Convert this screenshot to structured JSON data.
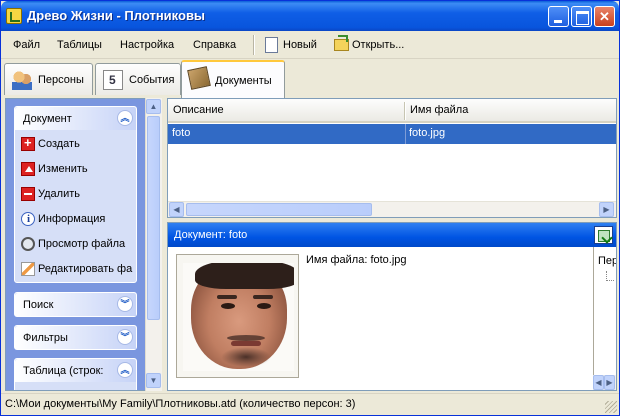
{
  "window": {
    "title": "Древо Жизни - Плотниковы"
  },
  "menu": {
    "items": [
      "Файл",
      "Таблицы",
      "Настройка",
      "Справка"
    ],
    "new_label": "Новый",
    "open_label": "Открыть..."
  },
  "tabs": [
    {
      "label": "Персоны",
      "active": false
    },
    {
      "label": "События",
      "active": false
    },
    {
      "label": "Документы",
      "active": true
    }
  ],
  "sidebar": {
    "document_panel": {
      "title": "Документ",
      "tasks": [
        "Создать",
        "Изменить",
        "Удалить",
        "Информация",
        "Просмотр файла",
        "Редактировать фа"
      ]
    },
    "search_panel": {
      "title": "Поиск"
    },
    "filters_panel": {
      "title": "Фильтры"
    },
    "table_panel": {
      "title": "Таблица (строк:"
    }
  },
  "grid": {
    "columns": [
      "Описание",
      "Имя файла"
    ],
    "rows": [
      {
        "description": "foto",
        "filename": "foto.jpg",
        "selected": true
      }
    ]
  },
  "detail": {
    "header": "Документ: foto",
    "file_info": "Имя файла: foto.jpg",
    "persons_label": "Пер"
  },
  "status": {
    "text": "C:\\Мои документы\\My Family\\Плотниковы.atd (количество персон: 3)"
  },
  "colors": {
    "selection": "#316ac5",
    "titlebar": "#0855dd",
    "taskpane": "#7a96df"
  }
}
